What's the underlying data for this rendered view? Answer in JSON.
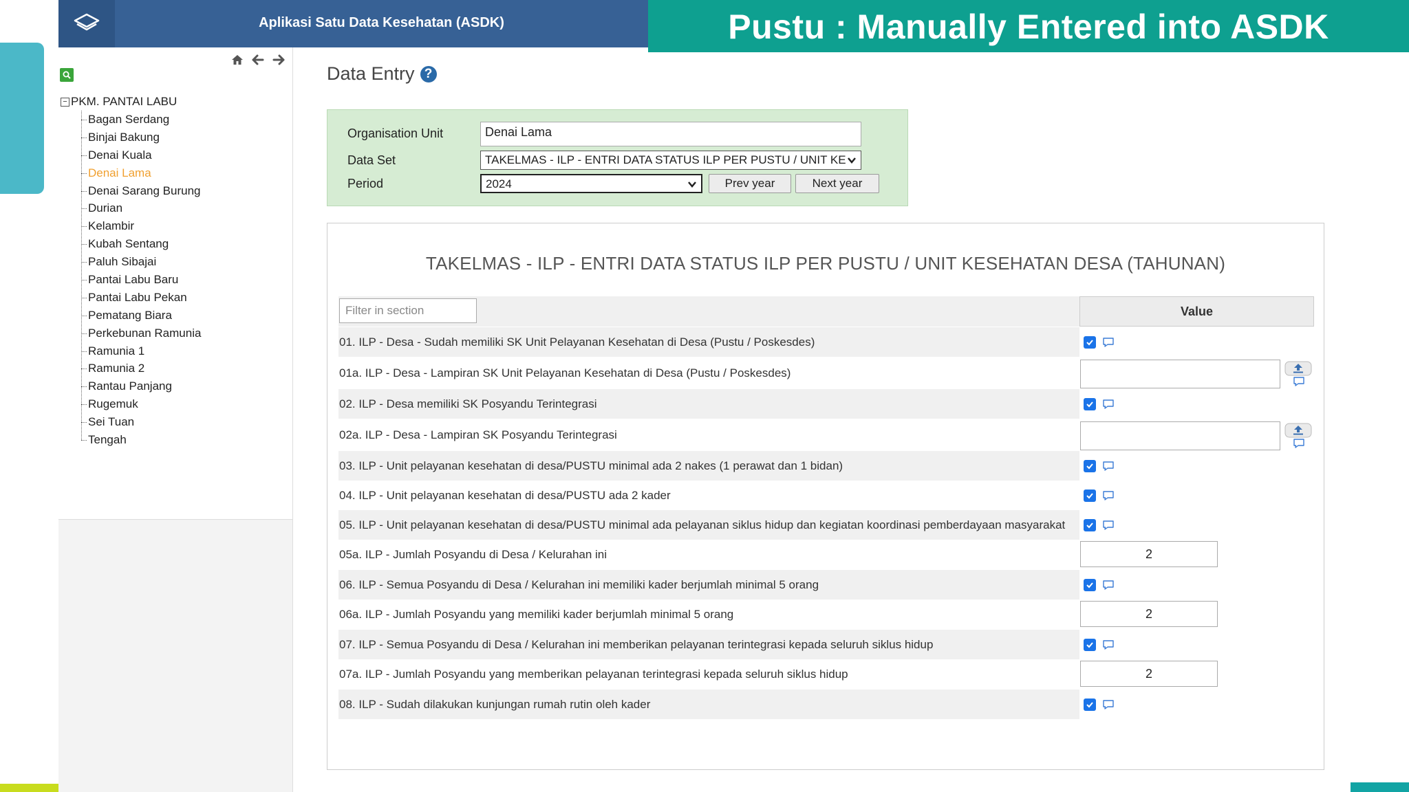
{
  "header": {
    "app_title": "Aplikasi Satu Data Kesehatan (ASDK)"
  },
  "banner": {
    "title": "Pustu : Manually Entered into ASDK"
  },
  "sidebar": {
    "root": "PKM. PANTAI LABU",
    "items": [
      "Bagan Serdang",
      "Binjai Bakung",
      "Denai Kuala",
      "Denai Lama",
      "Denai Sarang Burung",
      "Durian",
      "Kelambir",
      "Kubah Sentang",
      "Paluh Sibajai",
      "Pantai Labu Baru",
      "Pantai Labu Pekan",
      "Pematang Biara",
      "Perkebunan Ramunia",
      "Ramunia 1",
      "Ramunia 2",
      "Rantau Panjang",
      "Rugemuk",
      "Sei Tuan",
      "Tengah"
    ],
    "selected": "Denai Lama"
  },
  "page": {
    "title": "Data Entry"
  },
  "selection": {
    "org_unit_label": "Organisation Unit",
    "org_unit_value": "Denai Lama",
    "data_set_label": "Data Set",
    "data_set_value": "TAKELMAS - ILP - ENTRI DATA STATUS ILP PER PUSTU / UNIT KE",
    "period_label": "Period",
    "period_value": "2024",
    "prev_year": "Prev year",
    "next_year": "Next year"
  },
  "form": {
    "title": "TAKELMAS - ILP - ENTRI DATA STATUS ILP PER PUSTU / UNIT KESEHATAN DESA (TAHUNAN)",
    "filter_placeholder": "Filter in section",
    "value_header": "Value",
    "rows": [
      {
        "label": "01. ILP - Desa - Sudah memiliki SK Unit Pelayanan Kesehatan di Desa (Pustu / Poskesdes)",
        "type": "checkbox"
      },
      {
        "label": "01a. ILP - Desa - Lampiran SK Unit Pelayanan Kesehatan di Desa (Pustu / Poskesdes)",
        "type": "file"
      },
      {
        "label": "02. ILP - Desa memiliki SK Posyandu Terintegrasi",
        "type": "checkbox"
      },
      {
        "label": "02a. ILP - Desa - Lampiran SK Posyandu Terintegrasi",
        "type": "file"
      },
      {
        "label": "03. ILP - Unit pelayanan kesehatan di desa/PUSTU minimal ada 2 nakes (1 perawat dan 1 bidan)",
        "type": "checkbox"
      },
      {
        "label": "04. ILP - Unit pelayanan kesehatan di desa/PUSTU ada 2 kader",
        "type": "checkbox"
      },
      {
        "label": "05. ILP - Unit pelayanan kesehatan di desa/PUSTU minimal ada pelayanan siklus hidup dan kegiatan koordinasi pemberdayaan masyarakat",
        "type": "checkbox"
      },
      {
        "label": "05a. ILP - Jumlah Posyandu di Desa / Kelurahan ini",
        "type": "number",
        "value": "2"
      },
      {
        "label": "06. ILP - Semua Posyandu di Desa / Kelurahan ini memiliki kader berjumlah minimal 5 orang",
        "type": "checkbox"
      },
      {
        "label": "06a. ILP - Jumlah Posyandu yang memiliki kader berjumlah minimal 5 orang",
        "type": "number",
        "value": "2"
      },
      {
        "label": "07. ILP - Semua Posyandu di Desa / Kelurahan ini memberikan pelayanan terintegrasi kepada seluruh siklus hidup",
        "type": "checkbox"
      },
      {
        "label": "07a. ILP - Jumlah Posyandu yang memberikan pelayanan terintegrasi kepada seluruh siklus hidup",
        "type": "number",
        "value": "2"
      },
      {
        "label": "08. ILP - Sudah dilakukan kunjungan rumah rutin oleh kader",
        "type": "checkbox"
      }
    ]
  },
  "colors": {
    "header_bg": "#376195",
    "banner_bg": "#0ea090",
    "selection_bg": "#d6ecd3",
    "selected_tree_item": "#f0a030",
    "checkbox": "#1a73e8"
  }
}
